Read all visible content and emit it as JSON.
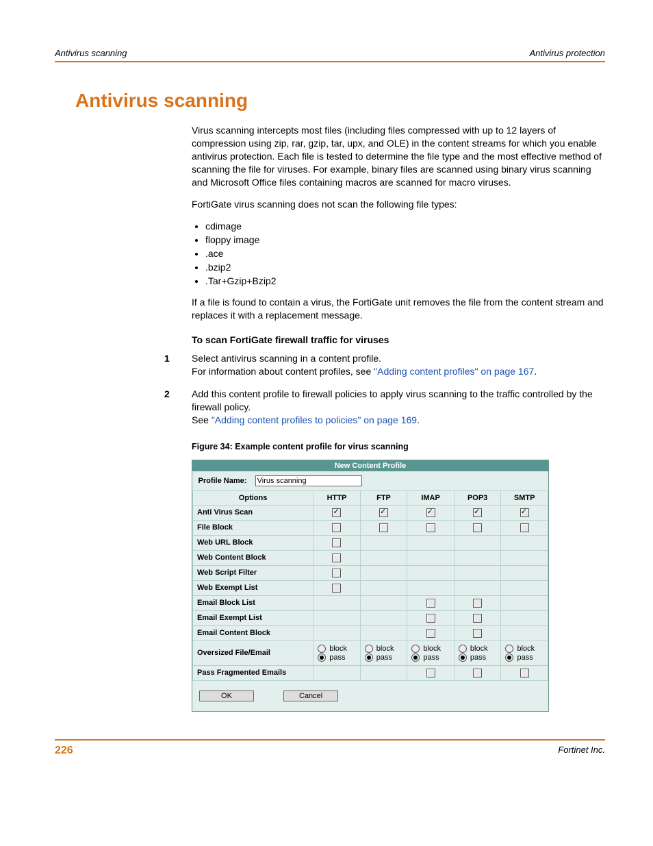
{
  "header": {
    "left": "Antivirus scanning",
    "right": "Antivirus protection"
  },
  "title": "Antivirus scanning",
  "p1": "Virus scanning intercepts most files (including files compressed with up to 12 layers of compression using zip, rar, gzip, tar, upx, and OLE) in the content streams for which you enable antivirus protection. Each file is tested to determine the file type and the most effective method of scanning the file for viruses. For example, binary files are scanned using binary virus scanning and Microsoft Office files containing macros are scanned for macro viruses.",
  "p2": "FortiGate virus scanning does not scan the following file types:",
  "bullets": [
    "cdimage",
    "floppy image",
    ".ace",
    ".bzip2",
    ".Tar+Gzip+Bzip2"
  ],
  "p3": "If a file is found to contain a virus, the FortiGate unit removes the file from the content stream and replaces it with a replacement message.",
  "subhead": "To scan FortiGate firewall traffic for viruses",
  "step1": {
    "num": "1",
    "l1": "Select antivirus scanning in a content profile.",
    "l2a": "For information about content profiles, see ",
    "l2link": "\"Adding content profiles\" on page 167",
    "l2b": "."
  },
  "step2": {
    "num": "2",
    "l1": "Add this content profile to firewall policies to apply virus scanning to the traffic controlled by the firewall policy.",
    "l2a": "See ",
    "l2link": "\"Adding content profiles to policies\" on page 169",
    "l2b": "."
  },
  "figcap": "Figure 34: Example content profile for virus scanning",
  "ncp": {
    "title": "New Content Profile",
    "pnLabel": "Profile Name:",
    "pnValue": "Virus scanning",
    "cols": [
      "Options",
      "HTTP",
      "FTP",
      "IMAP",
      "POP3",
      "SMTP"
    ],
    "rows": [
      {
        "name": "Anti Virus Scan",
        "c": [
          "cb1",
          "cb1",
          "cb1",
          "cb1",
          "cb1"
        ]
      },
      {
        "name": "File Block",
        "c": [
          "cb0",
          "cb0",
          "cb0",
          "cb0",
          "cb0"
        ]
      },
      {
        "name": "Web URL Block",
        "c": [
          "cb0",
          "",
          "",
          "",
          ""
        ]
      },
      {
        "name": "Web Content Block",
        "c": [
          "cb0",
          "",
          "",
          "",
          ""
        ]
      },
      {
        "name": "Web Script Filter",
        "c": [
          "cb0",
          "",
          "",
          "",
          ""
        ]
      },
      {
        "name": "Web Exempt List",
        "c": [
          "cb0",
          "",
          "",
          "",
          ""
        ]
      },
      {
        "name": "Email Block List",
        "c": [
          "",
          "",
          "cb0",
          "cb0",
          ""
        ]
      },
      {
        "name": "Email Exempt List",
        "c": [
          "",
          "",
          "cb0",
          "cb0",
          ""
        ]
      },
      {
        "name": "Email Content Block",
        "c": [
          "",
          "",
          "cb0",
          "cb0",
          ""
        ]
      },
      {
        "name": "Oversized File/Email",
        "c": [
          "bp",
          "bp",
          "bp",
          "bp",
          "bp"
        ]
      },
      {
        "name": "Pass Fragmented Emails",
        "c": [
          "",
          "",
          "cb0",
          "cb0",
          "cb0"
        ]
      }
    ],
    "blockLabel": "block",
    "passLabel": "pass",
    "ok": "OK",
    "cancel": "Cancel"
  },
  "footer": {
    "page": "226",
    "company": "Fortinet Inc."
  }
}
